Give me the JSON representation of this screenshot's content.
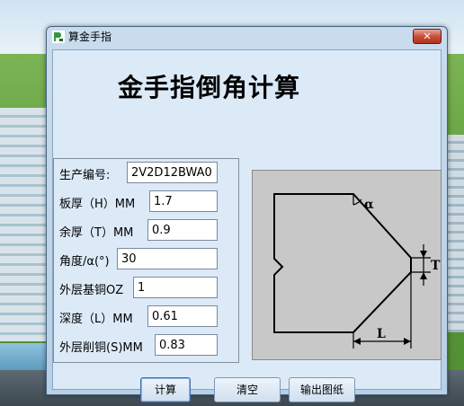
{
  "window": {
    "title": "算金手指",
    "close_glyph": "✕"
  },
  "main": {
    "heading": "金手指倒角计算"
  },
  "form": {
    "fields": [
      {
        "label": "生产编号:",
        "value": "2V2D12BWA0"
      },
      {
        "label": "板厚（H）MM",
        "value": "1.7"
      },
      {
        "label": "余厚（T）MM",
        "value": "0.9"
      },
      {
        "label": "角度/α(°)",
        "value": "30"
      },
      {
        "label": "外层基铜OZ",
        "value": "1"
      },
      {
        "label": "深度（L）MM",
        "value": "0.61"
      },
      {
        "label": "外层削铜(S)MM",
        "value": "0.83"
      }
    ]
  },
  "diagram": {
    "label_alpha": "α",
    "label_t": "T",
    "label_l": "L"
  },
  "buttons": {
    "calculate": "计算",
    "clear": "清空",
    "export": "输出图纸"
  },
  "colors": {
    "client_bg": "#dceaf8",
    "diagram_bg": "#c8c8c8",
    "close_red": "#c9503c",
    "app_icon_green": "#2e9a3c"
  },
  "icons": {
    "app": "app-icon",
    "close": "close-icon"
  }
}
